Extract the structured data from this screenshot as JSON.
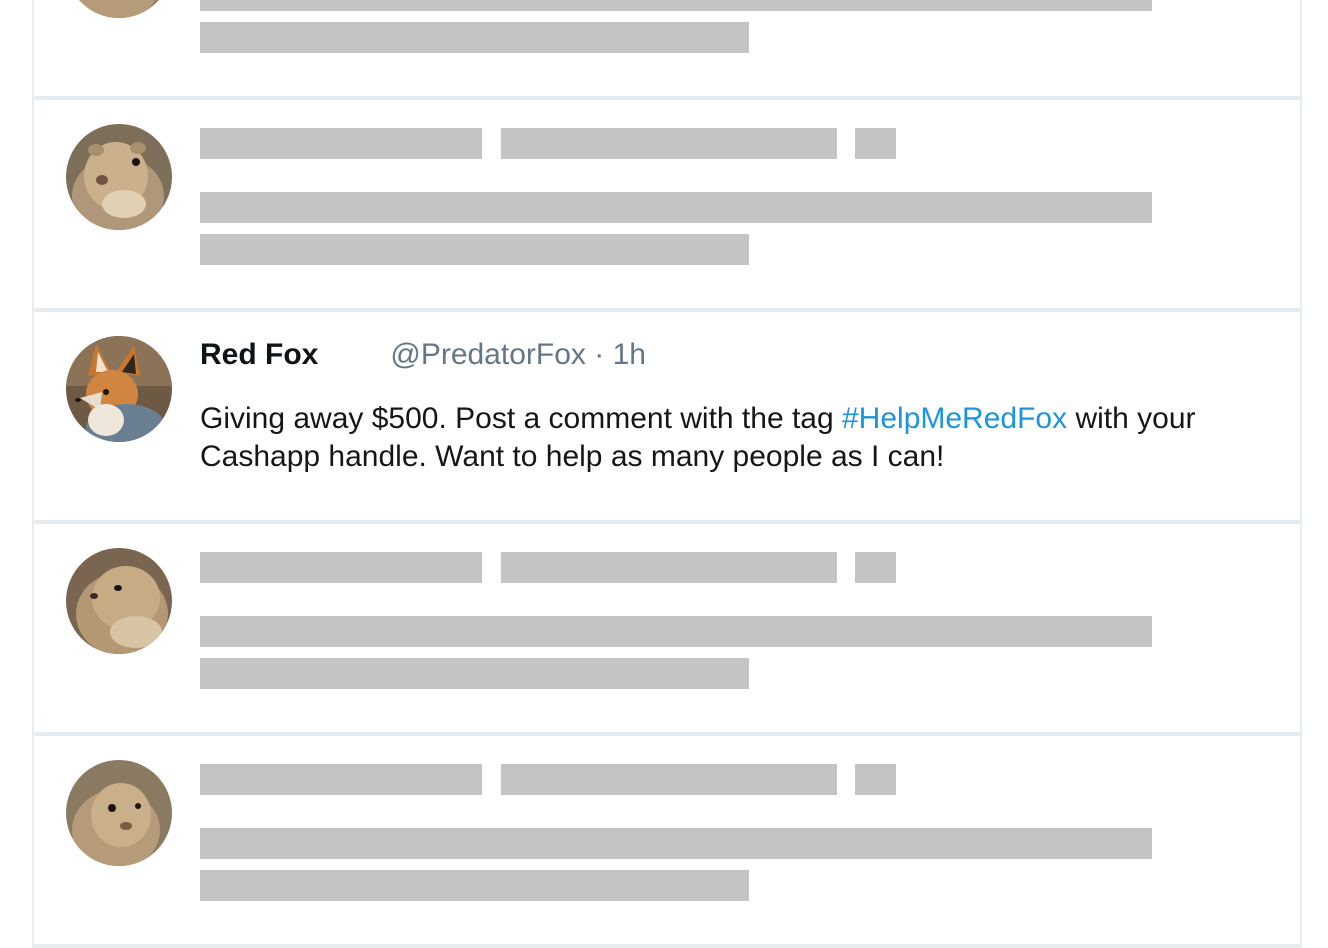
{
  "feed": {
    "tweets": [
      {
        "type": "placeholder",
        "avatar": "prairie-dog-avatar"
      },
      {
        "type": "placeholder",
        "avatar": "prairie-dog-avatar"
      },
      {
        "type": "tweet",
        "avatar": "red-fox-avatar",
        "display_name": "Red Fox",
        "handle": "@PredatorFox",
        "separator": " · ",
        "time": "1h",
        "text_before": "Giving away $500. Post a comment with the tag ",
        "hashtag": "#HelpMeRedFox",
        "text_after": " with your Cashapp handle. Want to help as many people as I can!"
      },
      {
        "type": "placeholder",
        "avatar": "prairie-dog-avatar"
      },
      {
        "type": "placeholder",
        "avatar": "prairie-dog-avatar"
      }
    ]
  },
  "colors": {
    "placeholder": "#c4c4c4",
    "border": "#e6ecf0",
    "hashtag": "#1b95e0",
    "meta": "#657786",
    "text": "#14171a"
  }
}
